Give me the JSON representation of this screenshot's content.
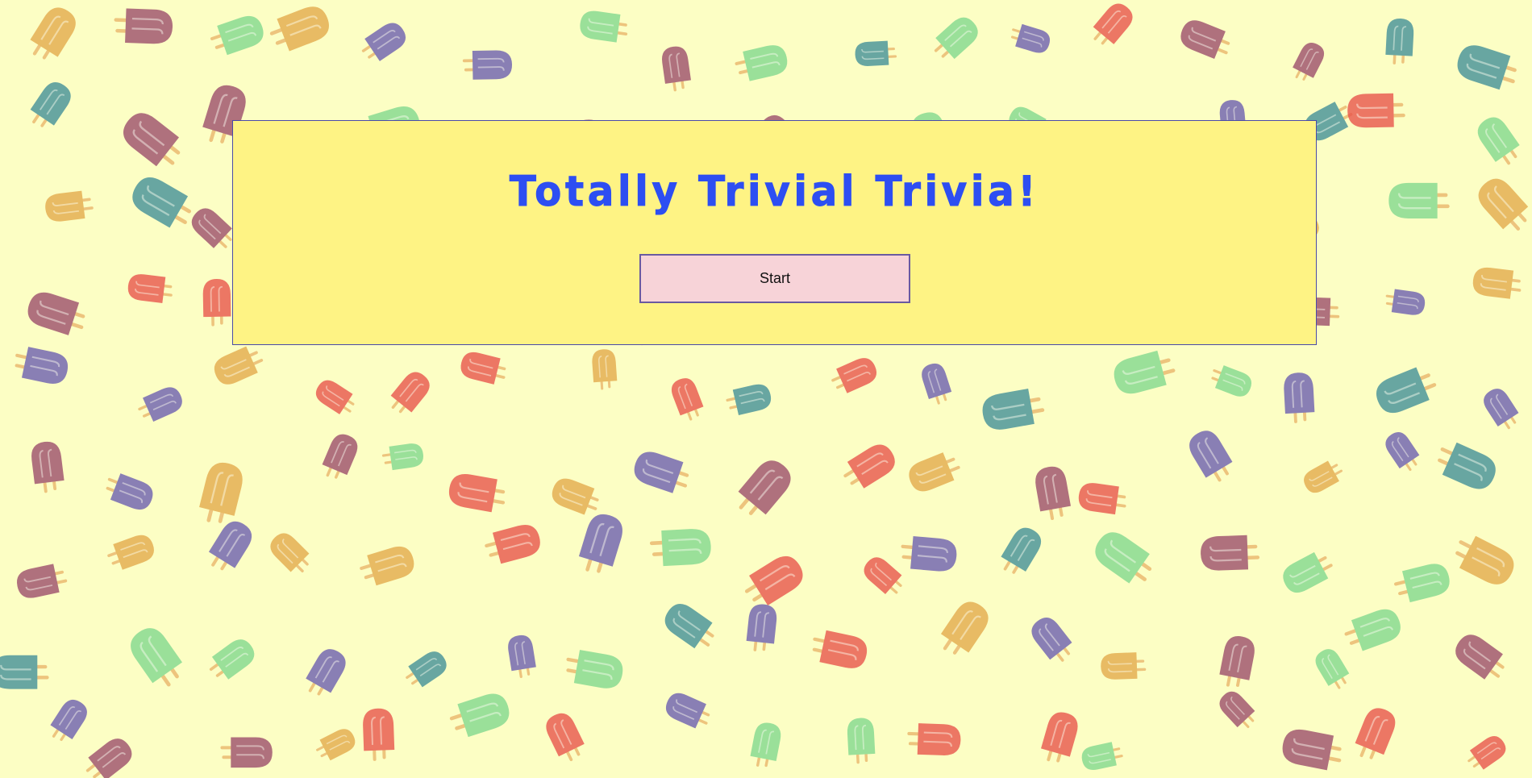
{
  "title": "Totally Trivial Trivia!",
  "start_label": "Start",
  "colors": {
    "page_background": "#fcfec4",
    "panel_background": "#fef384",
    "panel_border": "#4a4aa8",
    "title_text": "#2d4ef2",
    "button_background": "#f7d3d8",
    "button_border": "#6a5aa0"
  },
  "background_pattern": {
    "motif": "popsicle-icon",
    "palette": [
      "#e8524a",
      "#7fd88e",
      "#6a5cb0",
      "#3f8e98",
      "#9a4a6a",
      "#e3a94a"
    ]
  }
}
